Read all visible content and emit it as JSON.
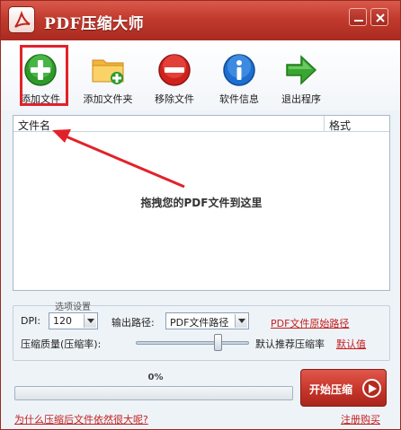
{
  "window": {
    "title": "PDF压缩大师"
  },
  "toolbar": {
    "add_file": "添加文件",
    "add_folder": "添加文件夹",
    "remove_file": "移除文件",
    "software_info": "软件信息",
    "exit": "退出程序"
  },
  "file_list": {
    "col_name": "文件名",
    "col_format": "格式",
    "drop_hint": "拖拽您的PDF文件到这里"
  },
  "options": {
    "title": "选项设置",
    "dpi_label": "DPI:",
    "dpi_value": "120",
    "output_path_label": "输出路径:",
    "output_path_value": "PDF文件路径",
    "original_path_link": "PDF文件原始路径",
    "quality_label": "压缩质量(压缩率):",
    "quality_level": 0.72,
    "recommend_text": "默认推荐压缩率",
    "default_link": "默认值"
  },
  "progress": {
    "percent_text": "0%",
    "fraction": 0
  },
  "actions": {
    "start_label": "开始压缩",
    "faq_link": "为什么压缩后文件依然很大呢?",
    "register_link": "注册购买"
  },
  "colors": {
    "title_bar": "#c23a2e",
    "link": "#c41e1e",
    "highlight": "#e2222a"
  }
}
